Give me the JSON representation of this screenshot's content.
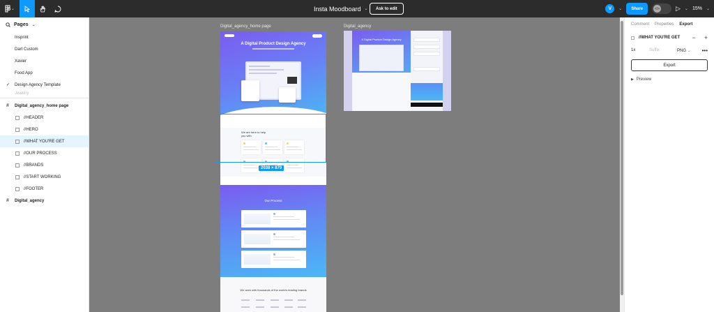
{
  "topbar": {
    "doc_title": "Insta Moodboard",
    "title_chevron": "⌄",
    "ask_to_edit": "Ask to edit",
    "avatar_initial": "V",
    "share": "Share",
    "devmode_glyph": "</>",
    "zoom": "15%",
    "tools": [
      {
        "name": "main-menu",
        "icon": "figma-logo-icon"
      },
      {
        "name": "move-tool",
        "icon": "cursor-icon"
      },
      {
        "name": "hand-tool",
        "icon": "hand-icon"
      },
      {
        "name": "comment-tool",
        "icon": "comment-icon"
      }
    ],
    "accent": "#0d99ff"
  },
  "left_panel": {
    "pages_label": "Pages",
    "pages": [
      {
        "label": "Insprint"
      },
      {
        "label": "Dart Custom"
      },
      {
        "label": "Xavier"
      },
      {
        "label": "Food App"
      },
      {
        "label": "Design Agency Template",
        "current": true
      },
      {
        "label": "Jewelry"
      }
    ],
    "layers": {
      "frame1": "Digital_agency_home page",
      "children": [
        {
          "label": "//HEADER"
        },
        {
          "label": "//HERO"
        },
        {
          "label": "//WHAT YOU'RE GET",
          "selected": true
        },
        {
          "label": "//OUR PROCESS"
        },
        {
          "label": "//BRANDS"
        },
        {
          "label": "//START WORKING"
        },
        {
          "label": "//FOOTER"
        }
      ],
      "frame2": "Digital_agency"
    }
  },
  "canvas": {
    "frame1_label": "Digital_agency_home page",
    "frame2_label": "Digital_agency",
    "frame1": {
      "hero_title": "A Digital Product Design Agency",
      "get_title": "We are here to help you with",
      "process_title": "Our Process",
      "brands_title": "We work with thousands of the world's leading brands"
    },
    "frame2": {
      "hero_title": "A Digital Product Design Agency"
    },
    "selection_size": "2038 × 879",
    "background": "#7d7d7d"
  },
  "right_panel": {
    "tabs": [
      {
        "label": "Comment"
      },
      {
        "label": "Properties"
      },
      {
        "label": "Export",
        "active": true
      }
    ],
    "selection_name": "//WHAT YOU'RE GET",
    "minus": "−",
    "plus": "+",
    "export_scale": "1x",
    "export_suffix_placeholder": "Suffix",
    "export_format": "PNG",
    "more": "•••",
    "export_button": "Export",
    "preview_label": "Preview"
  }
}
